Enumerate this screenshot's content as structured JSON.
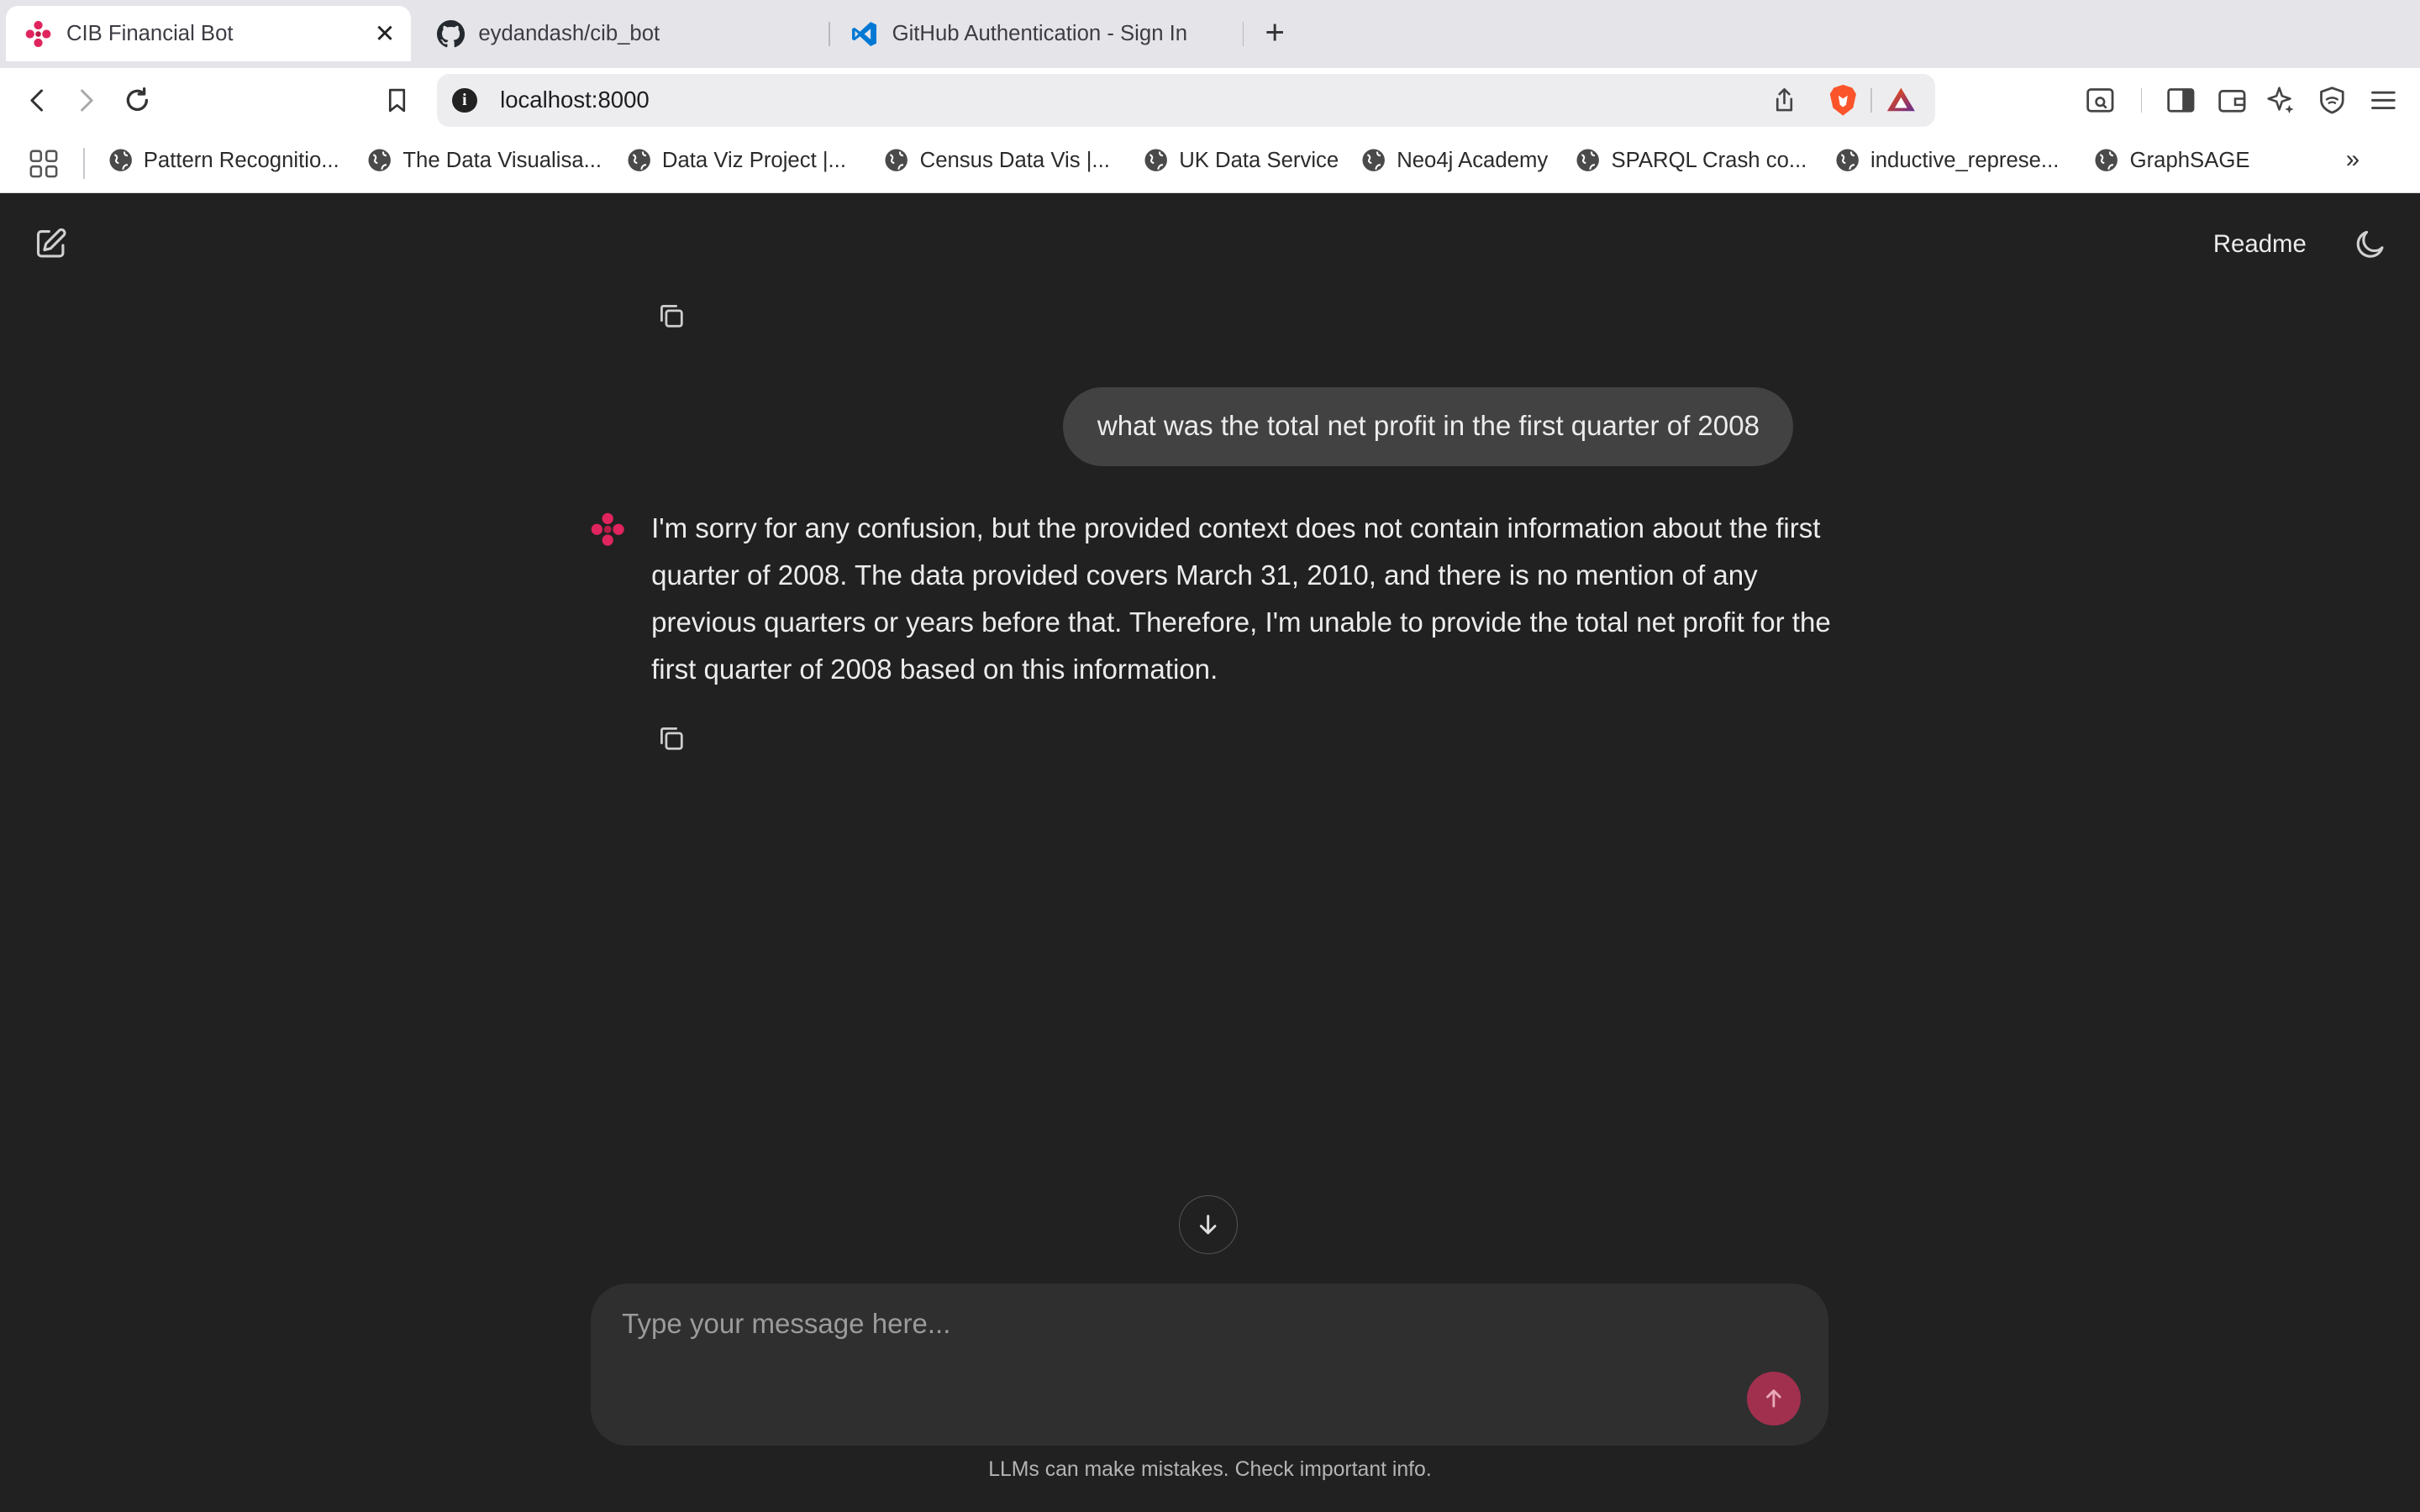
{
  "browser": {
    "tabs": [
      {
        "title": "CIB Financial Bot",
        "icon": "cib-logo-icon",
        "active": true
      },
      {
        "title": "eydandash/cib_bot",
        "icon": "github-icon",
        "active": false
      },
      {
        "title": "GitHub Authentication - Sign In",
        "icon": "vscode-icon",
        "active": false
      }
    ],
    "close_glyph": "✕",
    "new_tab_glyph": "+",
    "url": "localhost:8000",
    "info_glyph": "i",
    "bookmarks": [
      "Pattern Recognitio...",
      "The Data Visualisa...",
      "Data Viz Project |...",
      "Census Data Vis |...",
      "UK Data Service",
      "Neo4j Academy",
      "SPARQL Crash co...",
      "inductive_represe...",
      "GraphSAGE"
    ],
    "more_glyph": "»"
  },
  "app": {
    "readme_label": "Readme",
    "user_message": "what was the total net profit in the first quarter of 2008",
    "bot_message": "I'm sorry for any confusion, but the provided context does not contain information about the first quarter of 2008. The data provided covers March 31, 2010, and there is no mention of any previous quarters or years before that. Therefore, I'm unable to provide the total net profit for the first quarter of 2008 based on this information.",
    "input_placeholder": "Type your message here...",
    "disclaimer": "LLMs can make mistakes. Check important info.",
    "accent_color": "#e0245e",
    "send_color": "#a1304f"
  }
}
